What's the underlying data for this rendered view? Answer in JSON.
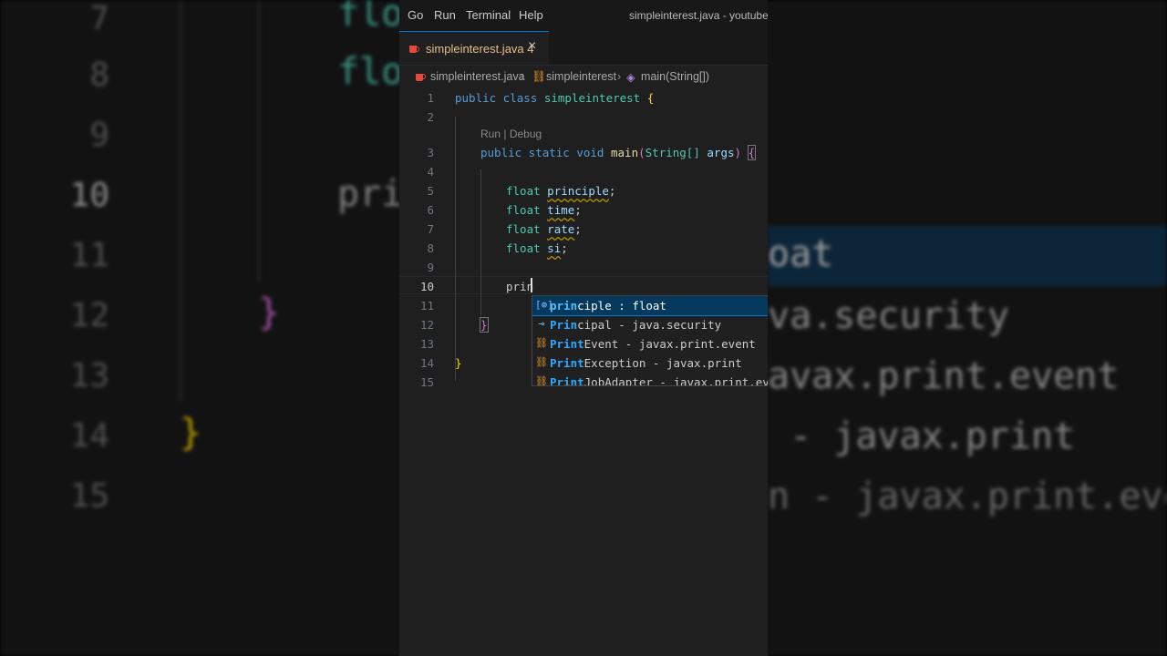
{
  "menu": {
    "items": [
      "Go",
      "Run",
      "Terminal",
      "Help"
    ],
    "window_title": "simpleinterest.java - youtubejav"
  },
  "tab": {
    "label": "simpleinterest.java",
    "problems": "4"
  },
  "breadcrumb": {
    "file": "simpleinterest.java",
    "class": "simpleinterest",
    "method": "main(String[])"
  },
  "codelens": {
    "run": "Run",
    "sep": "|",
    "debug": "Debug"
  },
  "line_numbers": [
    "1",
    "2",
    "3",
    "4",
    "5",
    "6",
    "7",
    "8",
    "9",
    "10",
    "11",
    "12",
    "13",
    "14",
    "15"
  ],
  "code": {
    "l1_kw": "public class",
    "l1_name": "simpleinterest",
    "l1_brace": "{",
    "l3_kw": "public static void",
    "l3_fn": "main",
    "l3_open": "(",
    "l3_type": "String[]",
    "l3_arg": "args",
    "l3_close": ")",
    "l3_brace": "{",
    "float": "float",
    "v5": "principle",
    "v6": "time",
    "v7": "rate",
    "v8": "si",
    "semi": ";",
    "l10": "prin",
    "l12_brace": "}",
    "l14_brace": "}"
  },
  "suggestions": [
    {
      "icon": "field-icon",
      "glyph": "[⊚]",
      "match": "prin",
      "rest": "ciple : float"
    },
    {
      "icon": "interface-icon",
      "glyph": "⊸",
      "match": "Prin",
      "rest": "cipal - java.security"
    },
    {
      "icon": "class-icon",
      "glyph": "⛓",
      "match": "Print",
      "rest": "Event - javax.print.event"
    },
    {
      "icon": "class-icon",
      "glyph": "⛓",
      "match": "Print",
      "rest": "Exception - javax.print"
    },
    {
      "icon": "class-icon",
      "glyph": "⛓",
      "match": "Print",
      "rest": "JobAdapter - javax.print.event"
    }
  ],
  "background_zoom": {
    "left_lines": [
      {
        "num": "7",
        "text": "flo"
      },
      {
        "num": "8",
        "text": "flo"
      },
      {
        "num": "9",
        "text": ""
      },
      {
        "num": "10",
        "text": "pri"
      },
      {
        "num": "11",
        "text": ""
      },
      {
        "num": "12",
        "text": "}"
      },
      {
        "num": "13",
        "text": ""
      },
      {
        "num": "14",
        "text": "}"
      },
      {
        "num": "15",
        "text": ""
      }
    ],
    "right_lines": [
      "oat",
      "va.security",
      "avax.print.event",
      " - javax.print",
      "n - javax.print.event"
    ]
  },
  "colors": {
    "editor_bg": "#1f1f1f",
    "keyword": "#569cd6",
    "type": "#4ec9b0",
    "function": "#dcdcaa",
    "variable": "#9cdcfe",
    "accent": "#0078d4"
  }
}
